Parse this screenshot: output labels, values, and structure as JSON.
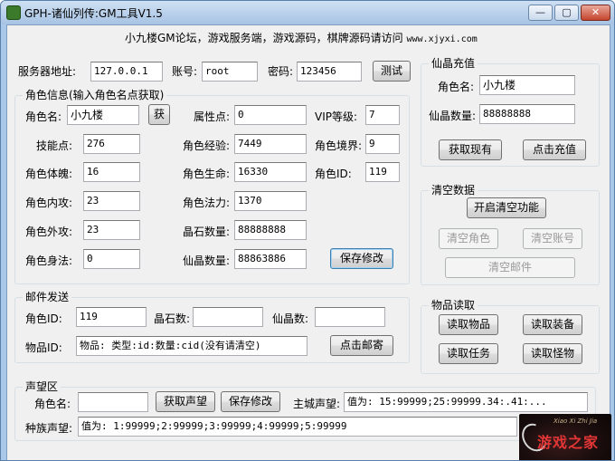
{
  "window": {
    "title": "GPH-诸仙列传:GM工具V1.5",
    "min": "—",
    "max": "▢",
    "close": "✕"
  },
  "banner": {
    "text": "小九楼GM论坛，游戏服务端，游戏源码，棋牌源码请访问",
    "url": "www.xjyxi.com"
  },
  "server": {
    "addr_label": "服务器地址:",
    "addr": "127.0.0.1",
    "account_label": "账号:",
    "account": "root",
    "password_label": "密码:",
    "password": "123456",
    "test_btn": "测试"
  },
  "role": {
    "title": "角色信息(输入角色名点获取)",
    "name_label": "角色名:",
    "name": "小九楼",
    "get_btn": "获",
    "attr_label": "属性点:",
    "attr": "0",
    "vip_label": "VIP等级:",
    "vip": "7",
    "skill_label": "技能点:",
    "skill": "276",
    "exp_label": "角色经验:",
    "exp": "7449",
    "realm_label": "角色境界:",
    "realm": "9",
    "con_label": "角色体魄:",
    "con": "16",
    "hp_label": "角色生命:",
    "hp": "16330",
    "id_label": "角色ID:",
    "id": "119",
    "inatk_label": "角色内攻:",
    "inatk": "23",
    "mp_label": "角色法力:",
    "mp": "1370",
    "outatk_label": "角色外攻:",
    "outatk": "23",
    "gem_label": "晶石数量:",
    "gem": "88888888",
    "body_label": "角色身法:",
    "body": "0",
    "crystal_label": "仙晶数量:",
    "crystal": "88863886",
    "save_btn": "保存修改"
  },
  "mail": {
    "title": "邮件发送",
    "id_label": "角色ID:",
    "id": "119",
    "gem_label": "晶石数:",
    "gem": "",
    "crystal_label": "仙晶数:",
    "crystal": "",
    "item_label": "物品ID:",
    "item": "物品: 类型:id:数量:cid(没有请清空)",
    "send_btn": "点击邮寄"
  },
  "reputation": {
    "title": "声望区",
    "name_label": "角色名:",
    "name": "",
    "get_btn": "获取声望",
    "save_btn": "保存修改",
    "city_label": "主城声望:",
    "city": "值为: 15:99999;25:99999.34:.41:...",
    "race_label": "种族声望:",
    "race": "值为: 1:99999;2:99999;3:99999;4:99999;5:99999"
  },
  "recharge": {
    "title": "仙晶充值",
    "name_label": "角色名:",
    "name": "小九楼",
    "amount_label": "仙晶数量:",
    "amount": "88888888",
    "get_btn": "获取现有",
    "charge_btn": "点击充值"
  },
  "clear": {
    "title": "清空数据",
    "enable_btn": "开启清空功能",
    "role_btn": "清空角色",
    "account_btn": "清空账号",
    "mail_btn": "清空邮件"
  },
  "items": {
    "title": "物品读取",
    "read_item": "读取物品",
    "read_equip": "读取装备",
    "read_task": "读取任务",
    "read_monster": "读取怪物"
  },
  "logo": {
    "sub": "Xiao Xi Zhi Jia",
    "main": "游戏之家"
  }
}
